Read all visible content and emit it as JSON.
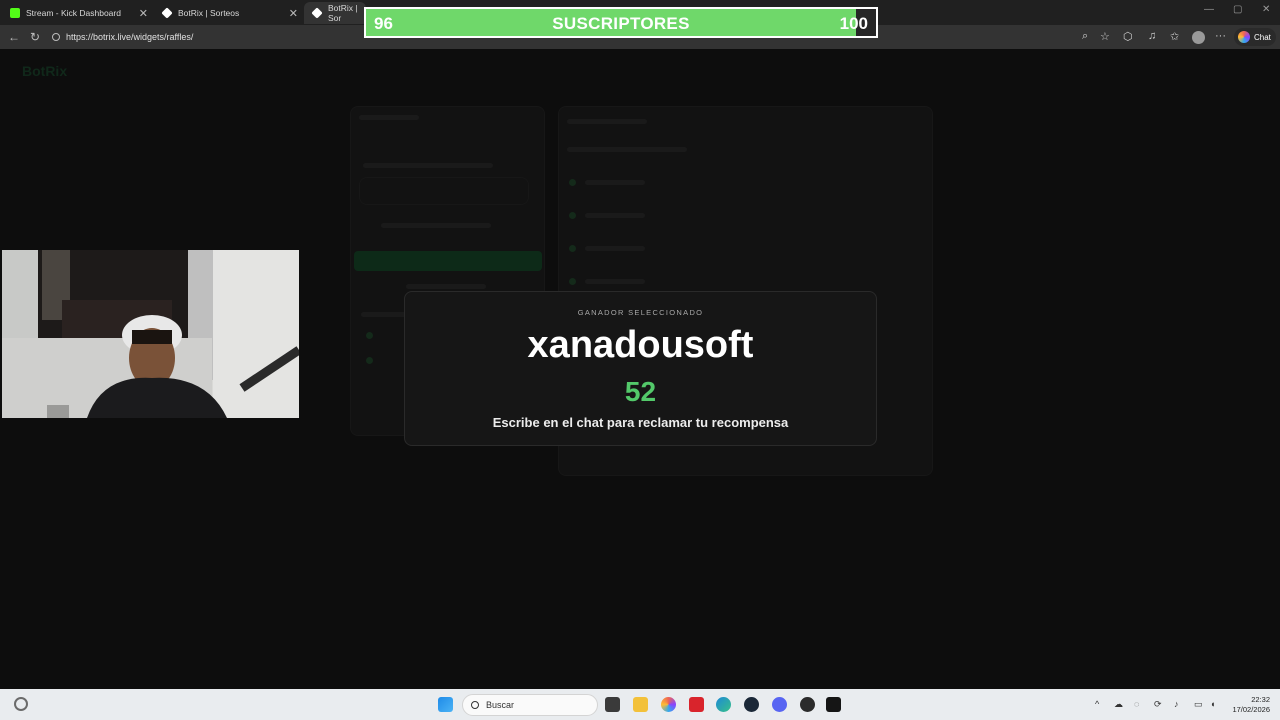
{
  "browser": {
    "tabs": [
      {
        "title": "Stream - Kick Dashboard",
        "favicon_color": "#53fc18"
      },
      {
        "title": "BotRix | Sorteos",
        "favicon_color": "#ffffff"
      },
      {
        "title": "BotRix | Sor",
        "favicon_color": "#ffffff"
      }
    ],
    "url": "https://botrix.live/widgets/raffles/",
    "chat_label": "Chat"
  },
  "subscriber_goal": {
    "current": "96",
    "goal": "100",
    "progress_fraction": 0.96,
    "label": "SUSCRIPTORES",
    "fill_color": "#6fd86a"
  },
  "raffle_result": {
    "kicker": "GANADOR SELECCIONADO",
    "winner_name": "xanadousoft",
    "winner_number": "52",
    "message": "Escribe en el chat para reclamar tu recompensa",
    "accent_color": "#53c96a"
  },
  "taskbar": {
    "search_placeholder": "Buscar",
    "clock_time": "22:32",
    "clock_date": "17/02/2026"
  }
}
